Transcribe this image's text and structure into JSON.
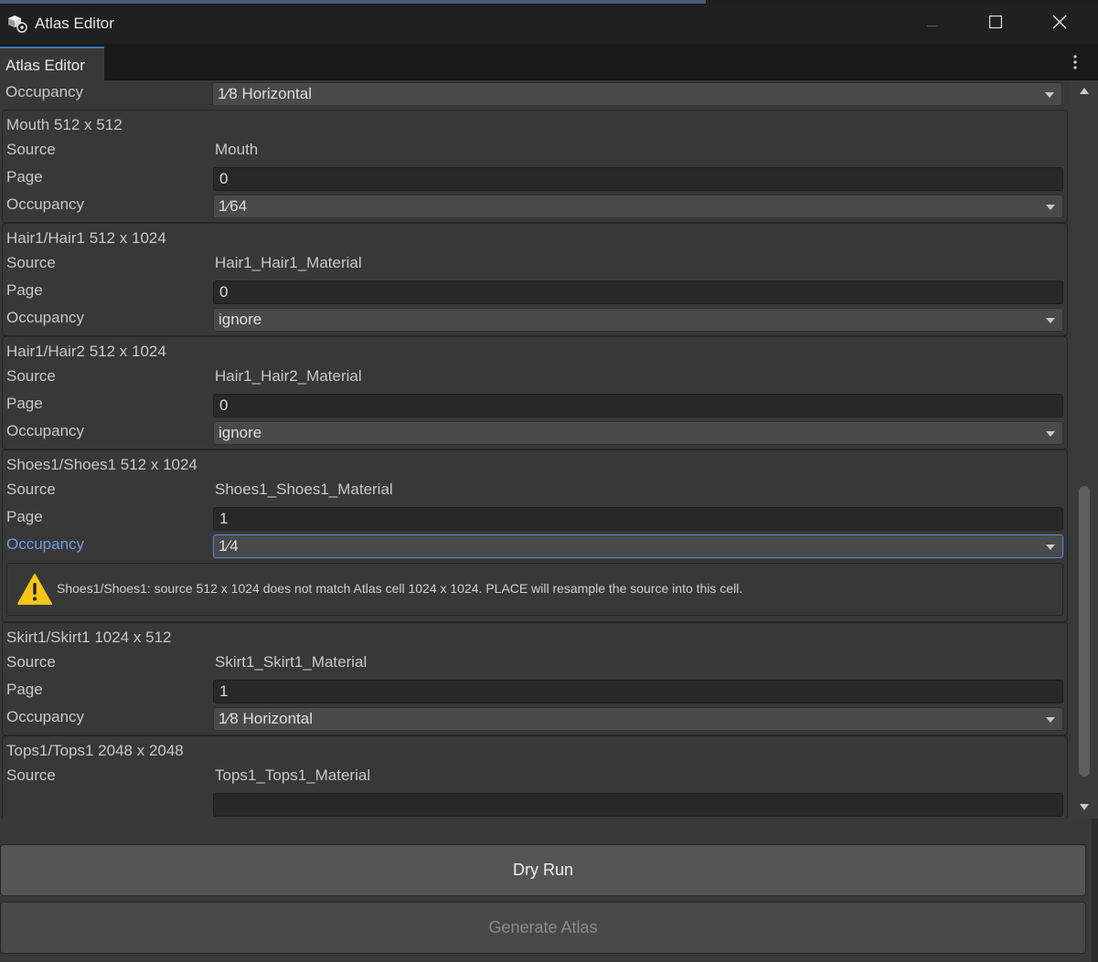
{
  "window": {
    "title": "Atlas Editor",
    "tab_label": "Atlas Editor"
  },
  "top_row": {
    "occupancy_label": "Occupancy",
    "occupancy_value": "1⁄8 Horizontal"
  },
  "entries": [
    {
      "header": "Mouth  512 x 512",
      "source_label": "Source",
      "source_value": "Mouth",
      "page_label": "Page",
      "page_value": "0",
      "occupancy_label": "Occupancy",
      "occupancy_value": "1⁄64"
    },
    {
      "header": "Hair1/Hair1  512 x 1024",
      "source_label": "Source",
      "source_value": "Hair1_Hair1_Material",
      "page_label": "Page",
      "page_value": "0",
      "occupancy_label": "Occupancy",
      "occupancy_value": "ignore"
    },
    {
      "header": "Hair1/Hair2  512 x 1024",
      "source_label": "Source",
      "source_value": "Hair1_Hair2_Material",
      "page_label": "Page",
      "page_value": "0",
      "occupancy_label": "Occupancy",
      "occupancy_value": "ignore"
    },
    {
      "header": "Shoes1/Shoes1  512 x 1024",
      "source_label": "Source",
      "source_value": "Shoes1_Shoes1_Material",
      "page_label": "Page",
      "page_value": "1",
      "occupancy_label": "Occupancy",
      "occupancy_value": "1⁄4",
      "warning": "Shoes1/Shoes1: source 512 x 1024 does not match Atlas cell 1024 x 1024. PLACE will resample the source into this cell."
    },
    {
      "header": "Skirt1/Skirt1  1024 x 512",
      "source_label": "Source",
      "source_value": "Skirt1_Skirt1_Material",
      "page_label": "Page",
      "page_value": "1",
      "occupancy_label": "Occupancy",
      "occupancy_value": "1⁄8 Horizontal"
    },
    {
      "header": "Tops1/Tops1  2048 x 2048",
      "source_label": "Source",
      "source_value": "Tops1_Tops1_Material"
    }
  ],
  "buttons": {
    "dry_run": "Dry Run",
    "generate": "Generate Atlas"
  },
  "colors": {
    "panel_bg": "#383838",
    "focus_accent": "#4d8fd8",
    "warning_yellow": "#f5c518"
  },
  "icons": {
    "app": "unity-cube-icon",
    "warning": "warning-triangle-icon",
    "menu": "kebab-menu-icon"
  }
}
